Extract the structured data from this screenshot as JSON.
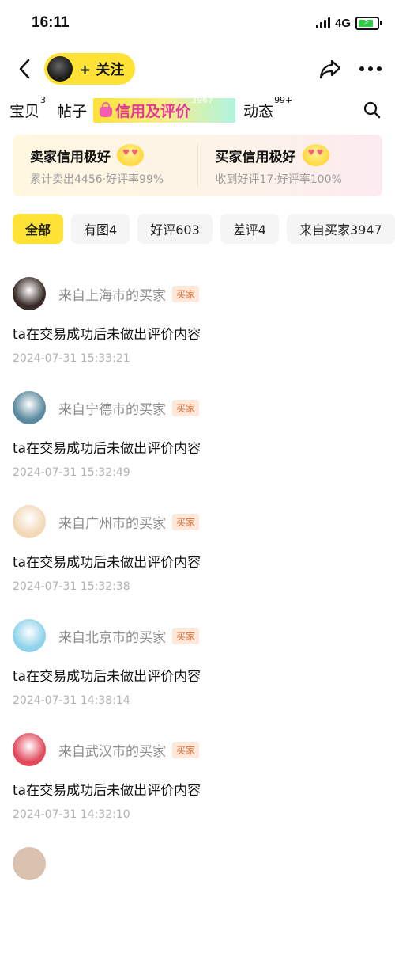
{
  "status_bar": {
    "time": "16:11",
    "network": "4G"
  },
  "header": {
    "follow_label": "+ 关注"
  },
  "tabs": [
    {
      "label": "宝贝",
      "count": "3"
    },
    {
      "label": "帖子",
      "count": ""
    },
    {
      "label": "信用及评价",
      "count": "3967"
    },
    {
      "label": "动态",
      "count": "99+"
    }
  ],
  "credit": {
    "seller": {
      "title": "卖家信用极好",
      "sub": "累计卖出4456·好评率99%"
    },
    "buyer": {
      "title": "买家信用极好",
      "sub": "收到好评17·好评率100%"
    }
  },
  "filters": [
    "全部",
    "有图4",
    "好评603",
    "差评4",
    "来自买家3947"
  ],
  "reviews": [
    {
      "from": "来自上海市的买家",
      "badge": "买家",
      "text": "ta在交易成功后未做出评价内容",
      "date": "2024-07-31 15:33:21",
      "avatar_color": "#3a2c28"
    },
    {
      "from": "来自宁德市的买家",
      "badge": "买家",
      "text": "ta在交易成功后未做出评价内容",
      "date": "2024-07-31 15:32:49",
      "avatar_color": "#5b8a9e"
    },
    {
      "from": "来自广州市的买家",
      "badge": "买家",
      "text": "ta在交易成功后未做出评价内容",
      "date": "2024-07-31 15:32:38",
      "avatar_color": "#f3d9b8"
    },
    {
      "from": "来自北京市的买家",
      "badge": "买家",
      "text": "ta在交易成功后未做出评价内容",
      "date": "2024-07-31 14:38:14",
      "avatar_color": "#8fd3ea"
    },
    {
      "from": "来自武汉市的买家",
      "badge": "买家",
      "text": "ta在交易成功后未做出评价内容",
      "date": "2024-07-31 14:32:10",
      "avatar_color": "#e24a5c"
    }
  ]
}
